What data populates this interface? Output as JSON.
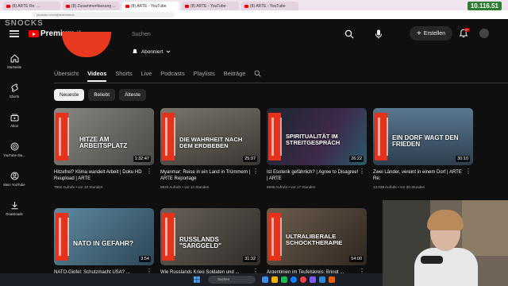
{
  "browser": {
    "tabs": [
      "(8) ARTE Re: ...",
      "(8) Zusammenfassung ...",
      "(8) ARTE - YouTube",
      "(8) ARTE - YouTube",
      "(8) ARTE - YouTube"
    ],
    "url": "youtube.com/@arte/videos",
    "clock": "10.116.51"
  },
  "header": {
    "channel_ghost_title": "SNOCKS",
    "logo_text": "Premium",
    "logo_cc": "DE",
    "search_placeholder": "Suchen",
    "create_label": "Erstellen",
    "notification_count": "9+"
  },
  "leftnav": [
    {
      "label": "Startseite",
      "icon": "home-icon"
    },
    {
      "label": "Shorts",
      "icon": "shorts-icon"
    },
    {
      "label": "Abos",
      "icon": "subscriptions-icon"
    },
    {
      "label": "YouTube Mu...",
      "icon": "youtube-music-icon"
    },
    {
      "label": "Mein YouTube",
      "icon": "you-icon"
    },
    {
      "label": "Downloads",
      "icon": "download-icon"
    }
  ],
  "channel": {
    "subscribe_label": "Abonniert"
  },
  "tabs": [
    "Übersicht",
    "Videos",
    "Shorts",
    "Live",
    "Podcasts",
    "Playlists",
    "Beiträge"
  ],
  "active_tab": "Videos",
  "chips": [
    "Neueste",
    "Beliebt",
    "Älteste"
  ],
  "active_chip": "Neueste",
  "videos": [
    {
      "thumb_title": "Hitze am Arbeitsplatz",
      "duration": "1:32:47",
      "title": "Hitzefrei? Klima wandelt Arbeit | Doku HD Reupload | ARTE",
      "meta": "7950 Aufrufe • vor 13 Stunden",
      "thumb_color": "#6b6a66"
    },
    {
      "thumb_title": "Die Wahrheit nach dem Erdbeben",
      "duration": "25:37",
      "title": "Myanmar: Reise in ein Land in Trümmern | ARTE Reportage",
      "meta": "6933 Aufrufe • vor 14 Stunden",
      "thumb_color": "#58534c"
    },
    {
      "thumb_title": "Spiritualität im Streitgespräch",
      "duration": "26:22",
      "title": "Ist Esoterik gefährlich? | Agree to Disagree! | ARTE",
      "meta": "6996 Aufrufe • vor 17 Stunden",
      "thumb_color": "#2a3340"
    },
    {
      "thumb_title": "Ein Dorf wagt den Frieden",
      "duration": "30:10",
      "title": "Zwei Länder, vereint in einem Dorf | ARTE Re:",
      "meta": "13.038 Aufrufe • vor 20 Stunden",
      "thumb_color": "#384a5c"
    },
    {
      "thumb_title": "NATO in Gefahr?",
      "duration": "3:54",
      "title": "NATO-Gipfel: Schutzmacht USA? ...",
      "meta": "",
      "thumb_color": "#3d5a6e"
    },
    {
      "thumb_title": "Russlands \"Sarggeld\"",
      "duration": "31:32",
      "title": "Wie Russlands Krieg Soldaten und ...",
      "meta": "",
      "thumb_color": "#4a4540"
    },
    {
      "thumb_title": "Ultraliberale Schocktherapie",
      "duration": "54:00",
      "title": "Argentinien im Teufelskreis: Bringt ...",
      "meta": "",
      "thumb_color": "#4d4237"
    },
    {
      "thumb_title": "",
      "duration": "",
      "title": "",
      "meta": "",
      "thumb_color": "#555"
    }
  ],
  "taskbar": {
    "search_placeholder": "Suchen"
  },
  "colors": {
    "background": "#0f0f0f",
    "accent_red": "#ff0000",
    "arte_orange": "#e5321b",
    "clock_green": "#2e7d32"
  }
}
